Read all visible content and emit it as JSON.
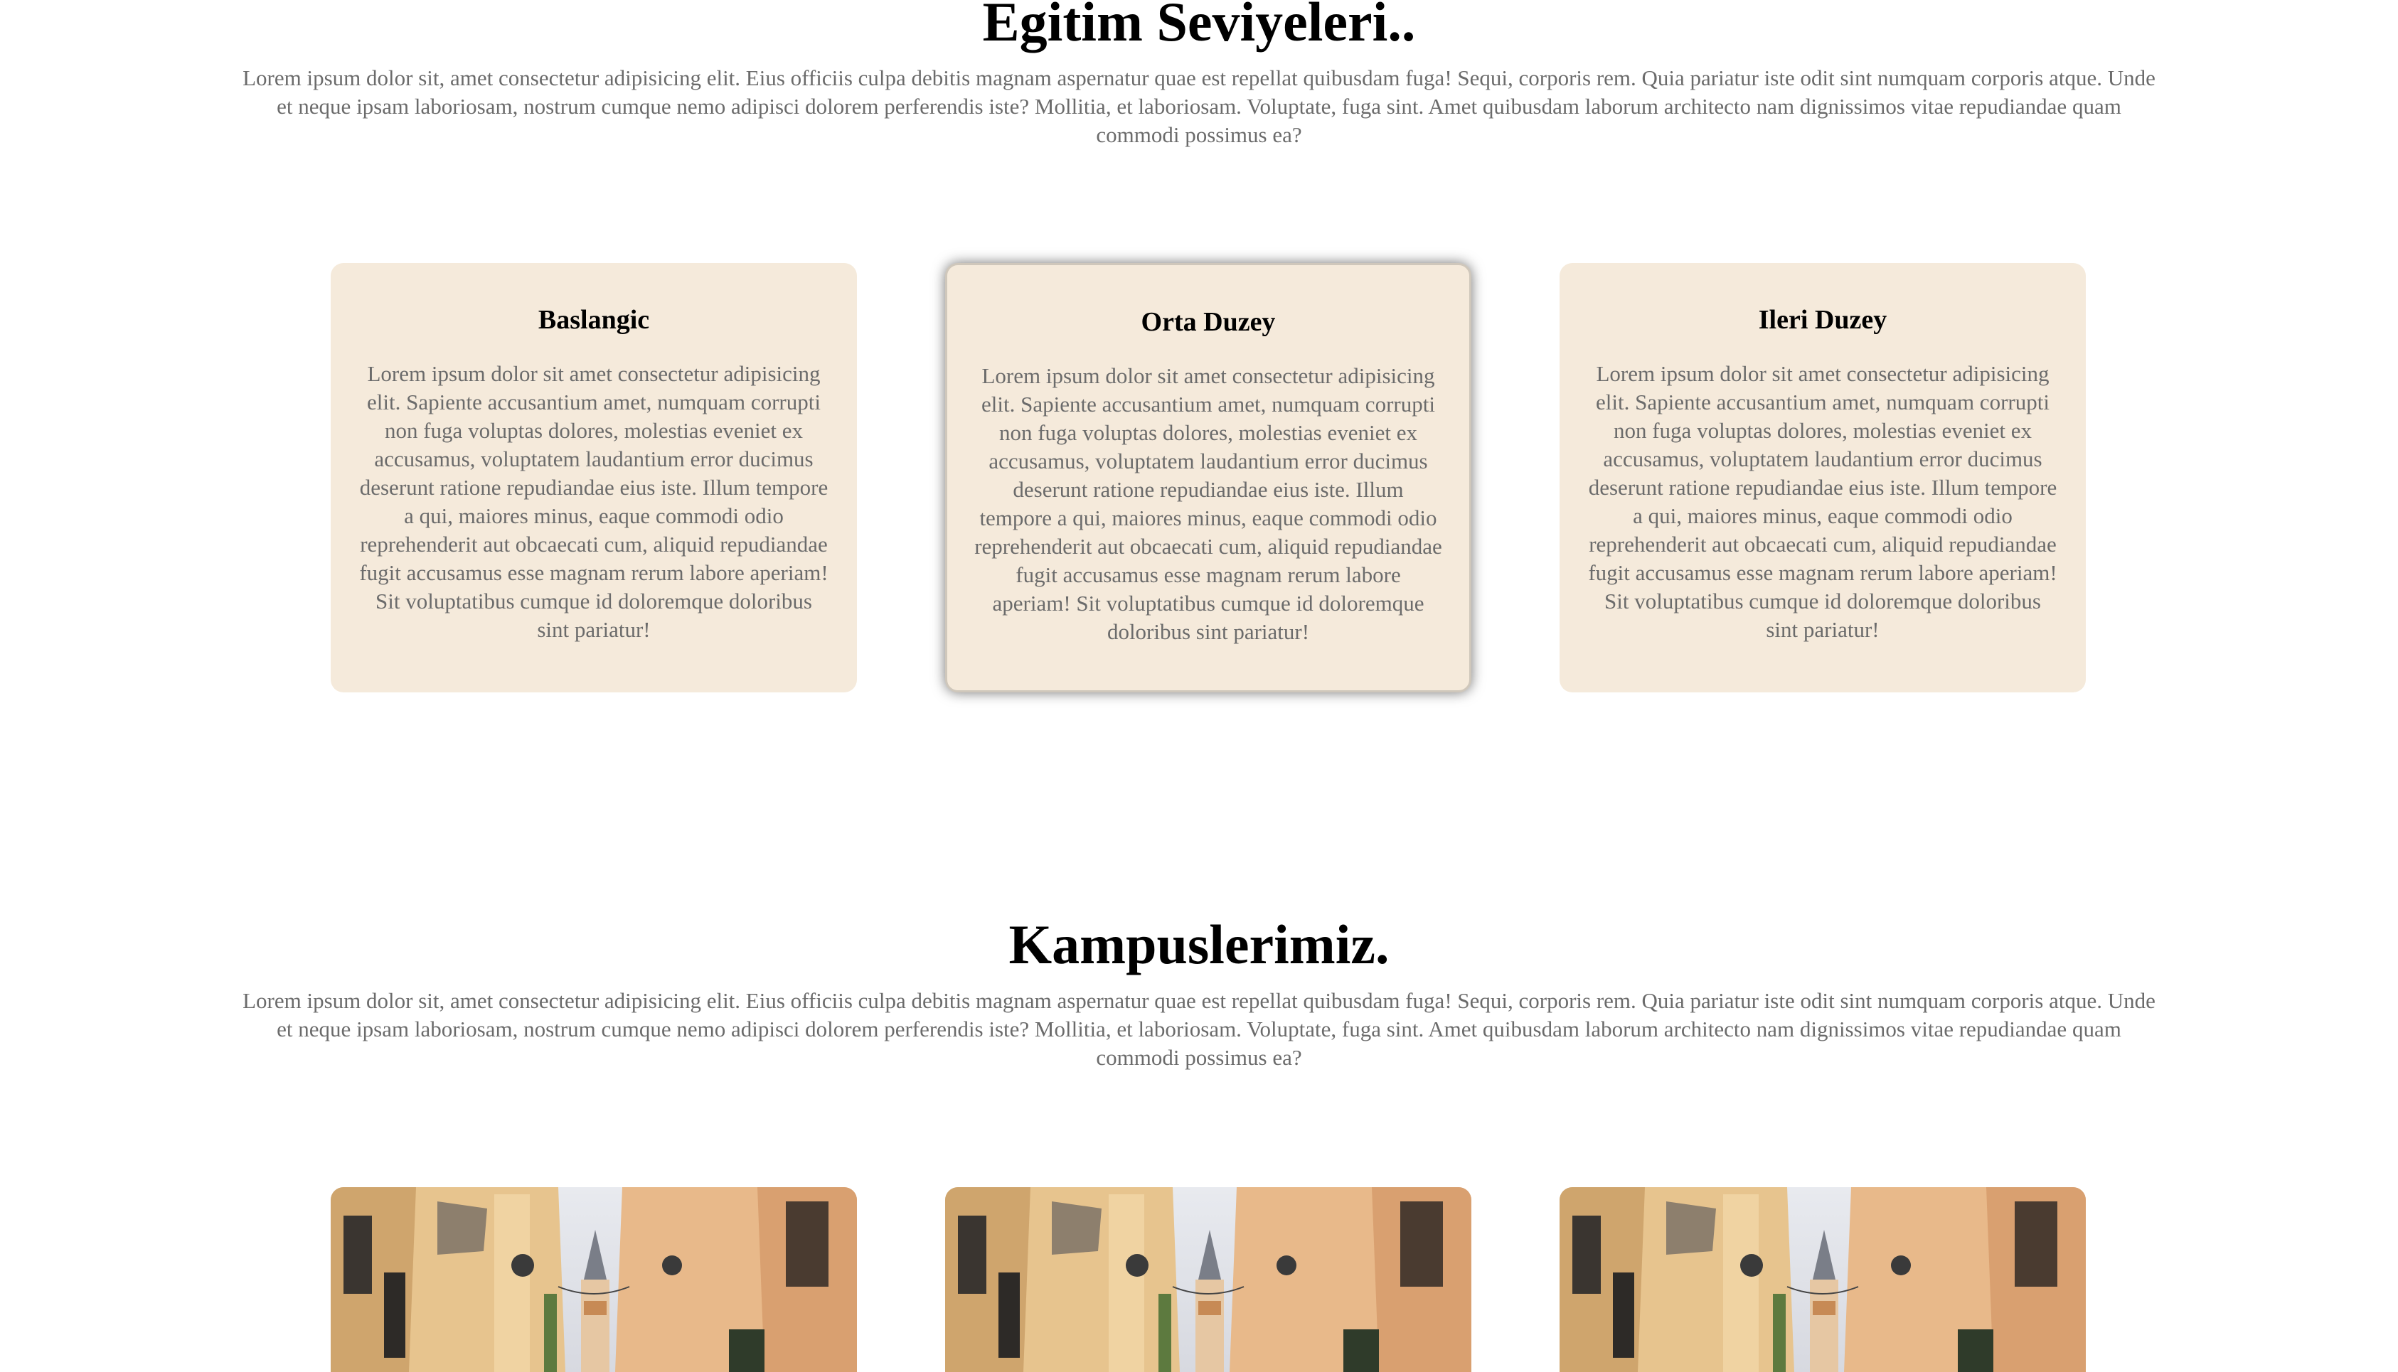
{
  "levels": {
    "title": "Egitim Seviyeleri..",
    "description": "Lorem ipsum dolor sit, amet consectetur adipisicing elit. Eius officiis culpa debitis magnam aspernatur quae est repellat quibusdam fuga! Sequi, corporis rem. Quia pariatur iste odit sint numquam corporis atque. Unde et neque ipsam laboriosam, nostrum cumque nemo adipisci dolorem perferendis iste? Mollitia, et laboriosam. Voluptate, fuga sint. Amet quibusdam laborum architecto nam dignissimos vitae repudiandae quam commodi possimus ea?",
    "cards": [
      {
        "title": "Baslangic",
        "text": "Lorem ipsum dolor sit amet consectetur adipisicing elit. Sapiente accusantium amet, numquam corrupti non fuga voluptas dolores, molestias eveniet ex accusamus, voluptatem laudantium error ducimus deserunt ratione repudiandae eius iste. Illum tempore a qui, maiores minus, eaque commodi odio reprehenderit aut obcaecati cum, aliquid repudiandae fugit accusamus esse magnam rerum labore aperiam! Sit voluptatibus cumque id doloremque doloribus sint pariatur!"
      },
      {
        "title": "Orta Duzey",
        "text": "Lorem ipsum dolor sit amet consectetur adipisicing elit. Sapiente accusantium amet, numquam corrupti non fuga voluptas dolores, molestias eveniet ex accusamus, voluptatem laudantium error ducimus deserunt ratione repudiandae eius iste. Illum tempore a qui, maiores minus, eaque commodi odio reprehenderit aut obcaecati cum, aliquid repudiandae fugit accusamus esse magnam rerum labore aperiam! Sit voluptatibus cumque id doloremque doloribus sint pariatur!"
      },
      {
        "title": "Ileri Duzey",
        "text": "Lorem ipsum dolor sit amet consectetur adipisicing elit. Sapiente accusantium amet, numquam corrupti non fuga voluptas dolores, molestias eveniet ex accusamus, voluptatem laudantium error ducimus deserunt ratione repudiandae eius iste. Illum tempore a qui, maiores minus, eaque commodi odio reprehenderit aut obcaecati cum, aliquid repudiandae fugit accusamus esse magnam rerum labore aperiam! Sit voluptatibus cumque id doloremque doloribus sint pariatur!"
      }
    ]
  },
  "campus": {
    "title": "Kampuslerimiz.",
    "description": "Lorem ipsum dolor sit, amet consectetur adipisicing elit. Eius officiis culpa debitis magnam aspernatur quae est repellat quibusdam fuga! Sequi, corporis rem. Quia pariatur iste odit sint numquam corporis atque. Unde et neque ipsam laboriosam, nostrum cumque nemo adipisci dolorem perferendis iste? Mollitia, et laboriosam. Voluptate, fuga sint. Amet quibusdam laborum architecto nam dignissimos vitae repudiandae quam commodi possimus ea?"
  },
  "colors": {
    "card_bg": "#f5eadb",
    "heading": "#000000",
    "body_text": "#6b6b6b"
  }
}
